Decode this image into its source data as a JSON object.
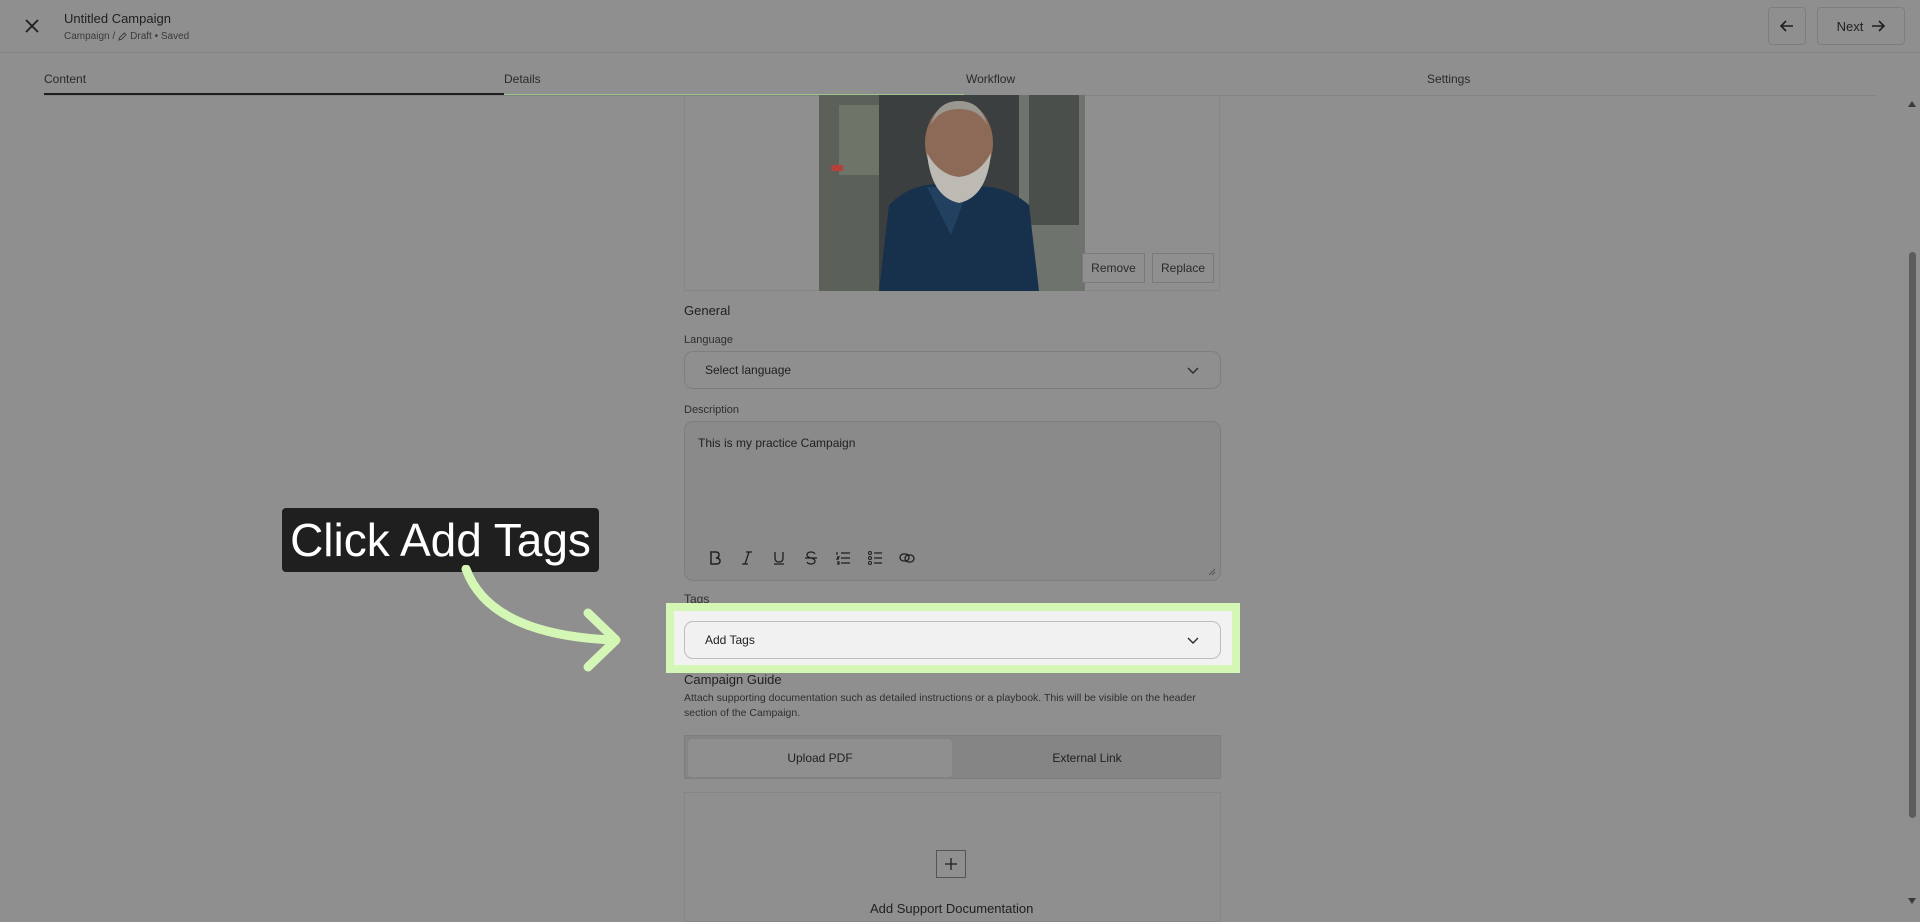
{
  "header": {
    "title": "Untitled Campaign",
    "breadcrumb": "Campaign /",
    "status": "Draft • Saved",
    "next_label": "Next"
  },
  "tabs": [
    {
      "label": "Content"
    },
    {
      "label": "Details"
    },
    {
      "label": "Workflow"
    },
    {
      "label": "Settings"
    }
  ],
  "image": {
    "remove_label": "Remove",
    "replace_label": "Replace"
  },
  "general": {
    "title": "General",
    "language_label": "Language",
    "language_placeholder": "Select language",
    "description_label": "Description",
    "description_value": "This is my practice Campaign"
  },
  "tags": {
    "label": "Tags",
    "placeholder": "Add Tags"
  },
  "guide": {
    "title": "Campaign Guide",
    "description": "Attach supporting documentation such as detailed instructions or a playbook. This will be visible on the header section of the Campaign.",
    "options": [
      "Upload PDF",
      "External Link"
    ],
    "add_label": "Add Support Documentation"
  },
  "overlay": {
    "tooltip": "Click Add Tags",
    "highlight_color": "#d4f7b6",
    "arrow_color": "#d4f7b6"
  },
  "icons": {
    "close": "close-icon",
    "edit": "pencil-icon",
    "back": "arrow-left-icon",
    "next": "arrow-right-icon",
    "chevron": "chevron-down-icon",
    "plus": "plus-icon"
  }
}
